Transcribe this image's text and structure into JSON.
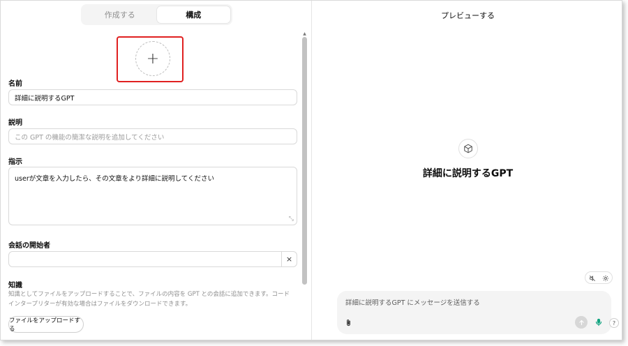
{
  "tabs": {
    "create": "作成する",
    "configure": "構成"
  },
  "avatar": {
    "plus": "+"
  },
  "form": {
    "name_label": "名前",
    "name_value": "詳細に説明するGPT",
    "description_label": "説明",
    "description_placeholder": "この GPT の機能の簡潔な説明を追加してください",
    "instructions_label": "指示",
    "instructions_value": "userが文章を入力したら、その文章をより詳細に説明してください",
    "starters_label": "会話の開始者",
    "starter_remove": "×",
    "knowledge_label": "知識",
    "knowledge_desc": "知識としてファイルをアップロードすることで、ファイルの内容を GPT との会話に追加できます。コード インタープリターが有効な場合はファイルをダウンロードできます。",
    "upload_button": "ファイルをアップロードする"
  },
  "preview": {
    "title": "プレビューする",
    "gpt_name": "詳細に説明するGPT",
    "composer_placeholder": "詳細に説明するGPT にメッセージを送信する",
    "help": "?"
  },
  "colors": {
    "highlight": "#e02020",
    "mic": "#10a37f"
  }
}
